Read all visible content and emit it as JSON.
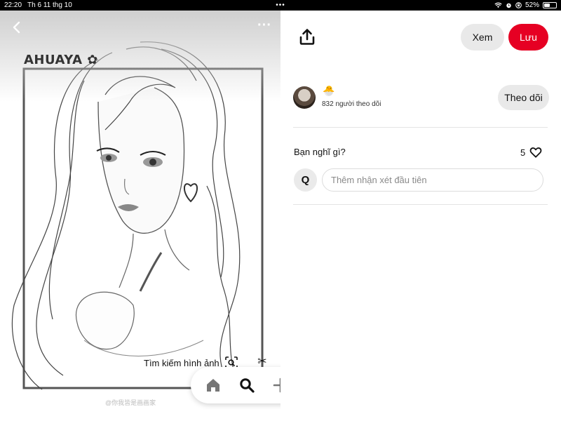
{
  "status_bar": {
    "time": "22:20",
    "date": "Th 6 11 thg 10",
    "center_dots": "•••",
    "battery_percent": "52%",
    "battery_level": 0.52
  },
  "pin": {
    "brand_watermark": "AHUAYA",
    "bottom_watermark": "@你我皆是画画家",
    "visual_search_label": "Tìm kiếm hình ảnh"
  },
  "header": {
    "view_label": "Xem",
    "save_label": "Lưu",
    "save_color": "#e60023"
  },
  "creator": {
    "emoji": "🐣",
    "followers": "832 người theo dõi",
    "follow_label": "Theo dõi"
  },
  "comments": {
    "title": "Bạn nghĩ gì?",
    "like_count": "5",
    "user_initial": "Q",
    "placeholder": "Thêm nhận xét đầu tiên"
  },
  "bottom_nav": {
    "items": [
      "home-icon",
      "search-icon",
      "plus-icon",
      "messages-icon",
      "profile-icon"
    ]
  }
}
